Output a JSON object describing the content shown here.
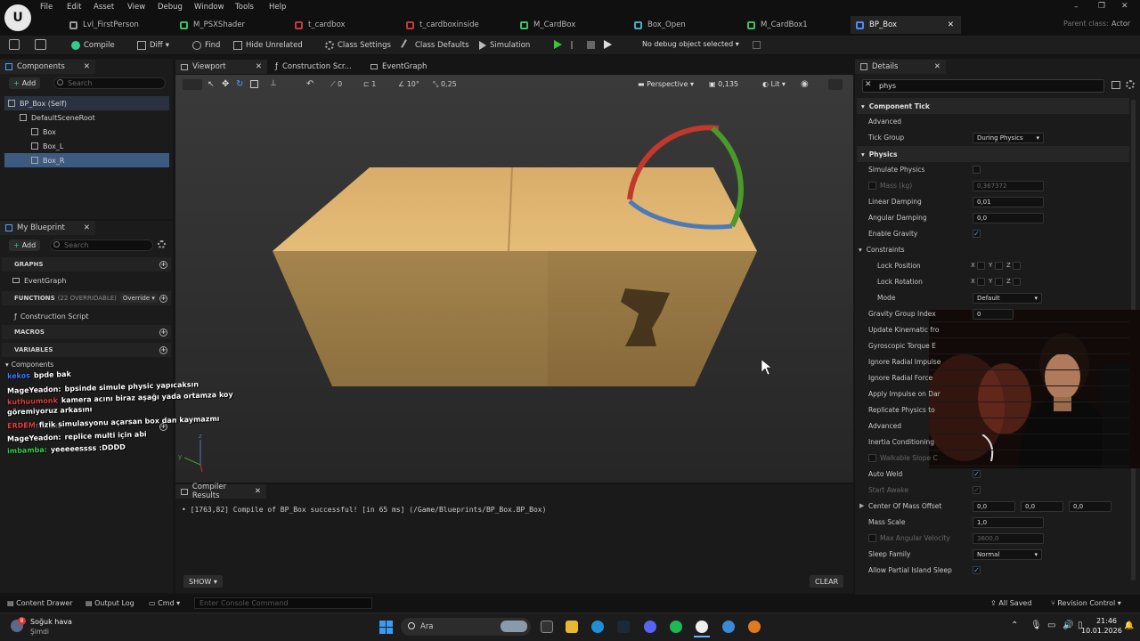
{
  "menu": [
    "File",
    "Edit",
    "Asset",
    "View",
    "Debug",
    "Window",
    "Tools",
    "Help"
  ],
  "doc_tabs": [
    {
      "label": "Lvl_FirstPerson",
      "icon": "level-icon",
      "color": "#9a9a9a"
    },
    {
      "label": "M_PSXShader",
      "icon": "material-icon",
      "color": "#3fbf5f"
    },
    {
      "label": "t_cardbox",
      "icon": "texture-icon",
      "color": "#c23a3a"
    },
    {
      "label": "t_cardboxinside",
      "icon": "texture-icon",
      "color": "#c23a3a"
    },
    {
      "label": "M_CardBox",
      "icon": "material-icon",
      "color": "#3fbf5f"
    },
    {
      "label": "Box_Open",
      "icon": "static-mesh-icon",
      "color": "#3fb0c0"
    },
    {
      "label": "M_CardBox1",
      "icon": "material-icon",
      "color": "#3fbf5f"
    },
    {
      "label": "BP_Box",
      "icon": "blueprint-icon",
      "color": "#4a8cff"
    }
  ],
  "parent_class": {
    "label": "Parent class:",
    "value": "Actor"
  },
  "toolbar": {
    "compile": "Compile",
    "diff": "Diff",
    "find": "Find",
    "hide_unrelated": "Hide Unrelated",
    "class_settings": "Class Settings",
    "class_defaults": "Class Defaults",
    "simulation": "Simulation",
    "debug_select": "No debug object selected"
  },
  "components": {
    "tab": "Components",
    "add": "Add",
    "search_placeholder": "Search",
    "tree": [
      {
        "label": "BP_Box (Self)",
        "indent": 0
      },
      {
        "label": "DefaultSceneRoot",
        "indent": 1
      },
      {
        "label": "Box",
        "indent": 2
      },
      {
        "label": "Box_L",
        "indent": 2
      },
      {
        "label": "Box_R",
        "indent": 2
      }
    ]
  },
  "my_blueprint": {
    "tab": "My Blueprint",
    "add": "Add",
    "search_placeholder": "Search",
    "graphs": "GRAPHS",
    "event_graph": "EventGraph",
    "functions": "FUNCTIONS",
    "functions_count": "(22 OVERRIDABLE)",
    "override": "Override",
    "construction_script": "Construction Script",
    "macros": "MACROS",
    "variables": "VARIABLES",
    "components_cat": "Components",
    "dispatchers": "DISPATCHERS"
  },
  "editor_tabs": [
    "Viewport",
    "Construction Scr...",
    "EventGraph"
  ],
  "viewport_toolbar": {
    "snap_deg": "10°",
    "snap_grid": "0",
    "snap_scale": "0,25",
    "perspective": "Perspective",
    "speed": "0,135",
    "lit": "Lit",
    "step": "1"
  },
  "compiler": {
    "tab": "Compiler Results",
    "message": "[1763,82] Compile of BP_Box successful! [in 65 ms] (/Game/Blueprints/BP_Box.BP_Box)",
    "show": "SHOW",
    "clear": "CLEAR"
  },
  "details": {
    "tab": "Details",
    "search_value": "phys",
    "rows": [
      {
        "type": "hdr",
        "label": "Component Tick"
      },
      {
        "type": "sub",
        "label": "Advanced"
      },
      {
        "type": "dd",
        "label": "Tick Group",
        "value": "During Physics"
      },
      {
        "type": "hdr",
        "label": "Physics"
      },
      {
        "type": "chk",
        "label": "Simulate Physics",
        "checked": false
      },
      {
        "type": "input",
        "label": "Mass (kg)",
        "value": "0,367372",
        "disabled": true,
        "check": true
      },
      {
        "type": "input",
        "label": "Linear Damping",
        "value": "0,01"
      },
      {
        "type": "input",
        "label": "Angular Damping",
        "value": "0,0"
      },
      {
        "type": "chk",
        "label": "Enable Gravity",
        "checked": true
      },
      {
        "type": "sub",
        "label": "Constraints"
      },
      {
        "type": "xyz",
        "label": "Lock Position"
      },
      {
        "type": "xyz",
        "label": "Lock Rotation"
      },
      {
        "type": "dd",
        "label": "Mode",
        "value": "Default",
        "indent": true
      },
      {
        "type": "input",
        "label": "Gravity Group Index",
        "value": "0"
      },
      {
        "type": "plain",
        "label": "Update Kinematic fro"
      },
      {
        "type": "plain",
        "label": "Gyroscopic Torque E"
      },
      {
        "type": "plain",
        "label": "Ignore Radial Impulse"
      },
      {
        "type": "plain",
        "label": "Ignore Radial Force"
      },
      {
        "type": "plain",
        "label": "Apply Impulse on Dar"
      },
      {
        "type": "plain",
        "label": "Replicate Physics to"
      },
      {
        "type": "sub",
        "label": "Advanced"
      },
      {
        "type": "plain",
        "label": "Inertia Conditioning"
      },
      {
        "type": "plain",
        "label": "Walkable Slope C",
        "disabled": true,
        "check": true
      },
      {
        "type": "chk",
        "label": "Auto Weld",
        "checked": true
      },
      {
        "type": "chk",
        "label": "Start Awake",
        "checked": true,
        "disabled": true
      },
      {
        "type": "vec",
        "label": "Center Of Mass Offset",
        "values": [
          "0,0",
          "0,0",
          "0,0"
        ]
      },
      {
        "type": "input",
        "label": "Mass Scale",
        "value": "1,0"
      },
      {
        "type": "input",
        "label": "Max Angular Velocity",
        "value": "3600,0",
        "disabled": true,
        "check": true
      },
      {
        "type": "dd",
        "label": "Sleep Family",
        "value": "Normal"
      },
      {
        "type": "chk",
        "label": "Allow Partial Island Sleep",
        "checked": true
      }
    ]
  },
  "chat": [
    {
      "user": "kekos",
      "msg": "bpde bak",
      "ucolor": "#3a7bff"
    },
    {
      "user": "MageYeadon:",
      "msg": "bpsinde simule physic yapıcaksın",
      "ucolor": "#ffffff"
    },
    {
      "user": "kuthuumonk",
      "msg": "kamera acını biraz aşağı yada ortamza koy",
      "ucolor": "#e04040"
    },
    {
      "user": "",
      "msg": "göremiyoruz arkasını",
      "ucolor": "#ffffff"
    },
    {
      "user": "ERDEM",
      "msg": "fizik simulasyonu açarsan box dan kaymazmı",
      "ucolor": "#e04040"
    },
    {
      "user": "MageYeadon:",
      "msg": "replice multi için abi",
      "ucolor": "#ffffff"
    },
    {
      "user": "imbamba:",
      "msg": "yeeeeessss :DDDD",
      "ucolor": "#3ad04a"
    }
  ],
  "statusbar": {
    "content_drawer": "Content Drawer",
    "output_log": "Output Log",
    "cmd": "Cmd",
    "console_placeholder": "Enter Console Command",
    "all_saved": "All Saved",
    "revision": "Revision Control"
  },
  "taskbar": {
    "weather_title": "Soğuk hava",
    "weather_sub": "Şimdi",
    "weather_badge": "8",
    "search": "Ara",
    "time": "21:46",
    "date": "10.01.2026"
  }
}
